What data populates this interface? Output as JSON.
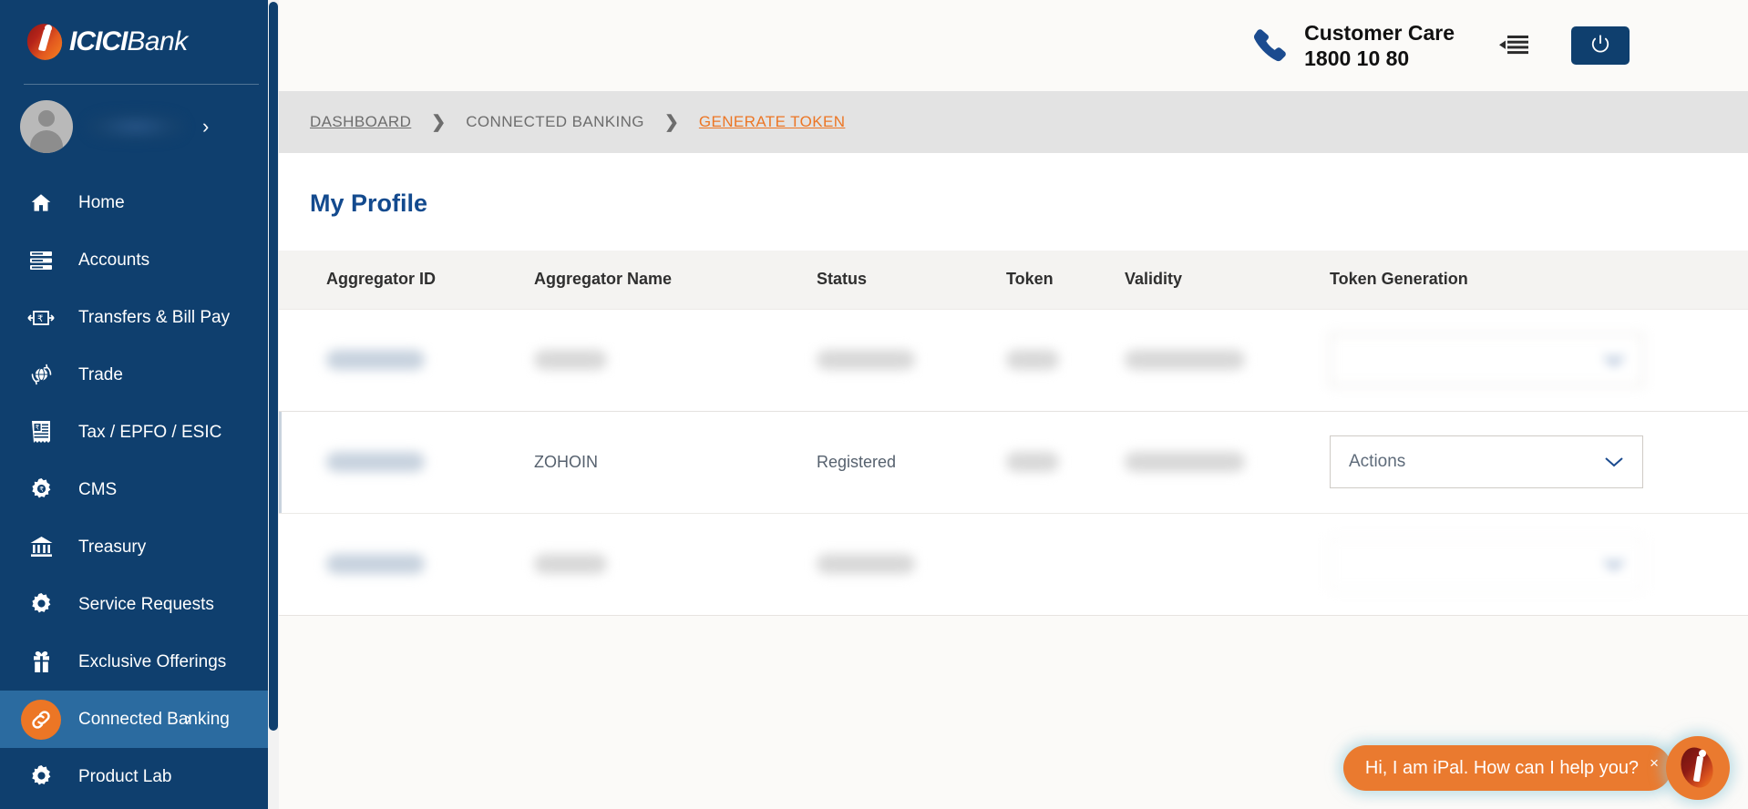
{
  "brand": {
    "name_bold": "ICICI",
    "name_light": "Bank",
    "logo_icon": "icici-i-logo"
  },
  "sidebar": {
    "profile": {
      "name_masked": "",
      "chevron": "›"
    },
    "items": [
      {
        "label": "Home",
        "icon": "home-icon",
        "active": false
      },
      {
        "label": "Accounts",
        "icon": "accounts-icon",
        "active": false
      },
      {
        "label": "Transfers & Bill Pay",
        "icon": "transfers-icon",
        "active": false
      },
      {
        "label": "Trade",
        "icon": "trade-globe-icon",
        "active": false
      },
      {
        "label": "Tax / EPFO / ESIC",
        "icon": "tax-receipt-icon",
        "active": false
      },
      {
        "label": "CMS",
        "icon": "cms-gear-icon",
        "active": false
      },
      {
        "label": "Treasury",
        "icon": "treasury-bank-icon",
        "active": false
      },
      {
        "label": "Service Requests",
        "icon": "gear-icon",
        "active": false
      },
      {
        "label": "Exclusive Offerings",
        "icon": "gift-icon",
        "active": false
      },
      {
        "label": "Connected Banking",
        "icon": "link-chain-icon",
        "active": true,
        "arrow": "›"
      },
      {
        "label": "Product Lab",
        "icon": "gear-icon",
        "active": false
      }
    ]
  },
  "topbar": {
    "customer_care_label": "Customer Care",
    "customer_care_number": "1800 10 80",
    "phone_icon": "phone-icon",
    "collapse_icon": "collapse-sidebar-icon",
    "power_icon": "power-icon"
  },
  "breadcrumb": {
    "items": [
      {
        "label": "DASHBOARD",
        "current": false
      },
      {
        "label": "CONNECTED BANKING",
        "current": false
      },
      {
        "label": "GENERATE TOKEN",
        "current": true
      }
    ],
    "separator": "❯"
  },
  "page": {
    "title": "My Profile"
  },
  "table": {
    "columns": [
      "Aggregator ID",
      "Aggregator Name",
      "Status",
      "Token",
      "Validity",
      "Token Generation"
    ],
    "rows": [
      {
        "aggregator_id": "",
        "aggregator_name": "",
        "status": "",
        "token": "",
        "validity": "",
        "action_label": "",
        "masked": true,
        "selected": false
      },
      {
        "aggregator_id": "",
        "aggregator_name": "ZOHOIN",
        "status": "Registered",
        "token": "",
        "validity": "",
        "action_label": "Actions",
        "masked": false,
        "selected": true
      },
      {
        "aggregator_id": "",
        "aggregator_name": "",
        "status": "",
        "token": "",
        "validity": "",
        "action_label": "",
        "masked": true,
        "selected": false
      }
    ]
  },
  "chat": {
    "message": "Hi, I am iPal. How can I help you?",
    "close_label": "×",
    "avatar_icon": "ipal-logo-icon"
  },
  "colors": {
    "sidebar_bg": "#0f3f6e",
    "sidebar_active_bg": "#2b6ba0",
    "accent_orange": "#ec7625",
    "brand_blue": "#134a8e",
    "breadcrumb_bg": "#e3e3e3",
    "page_bg": "#fbfaf8",
    "table_header_bg": "#f4f3f1"
  }
}
